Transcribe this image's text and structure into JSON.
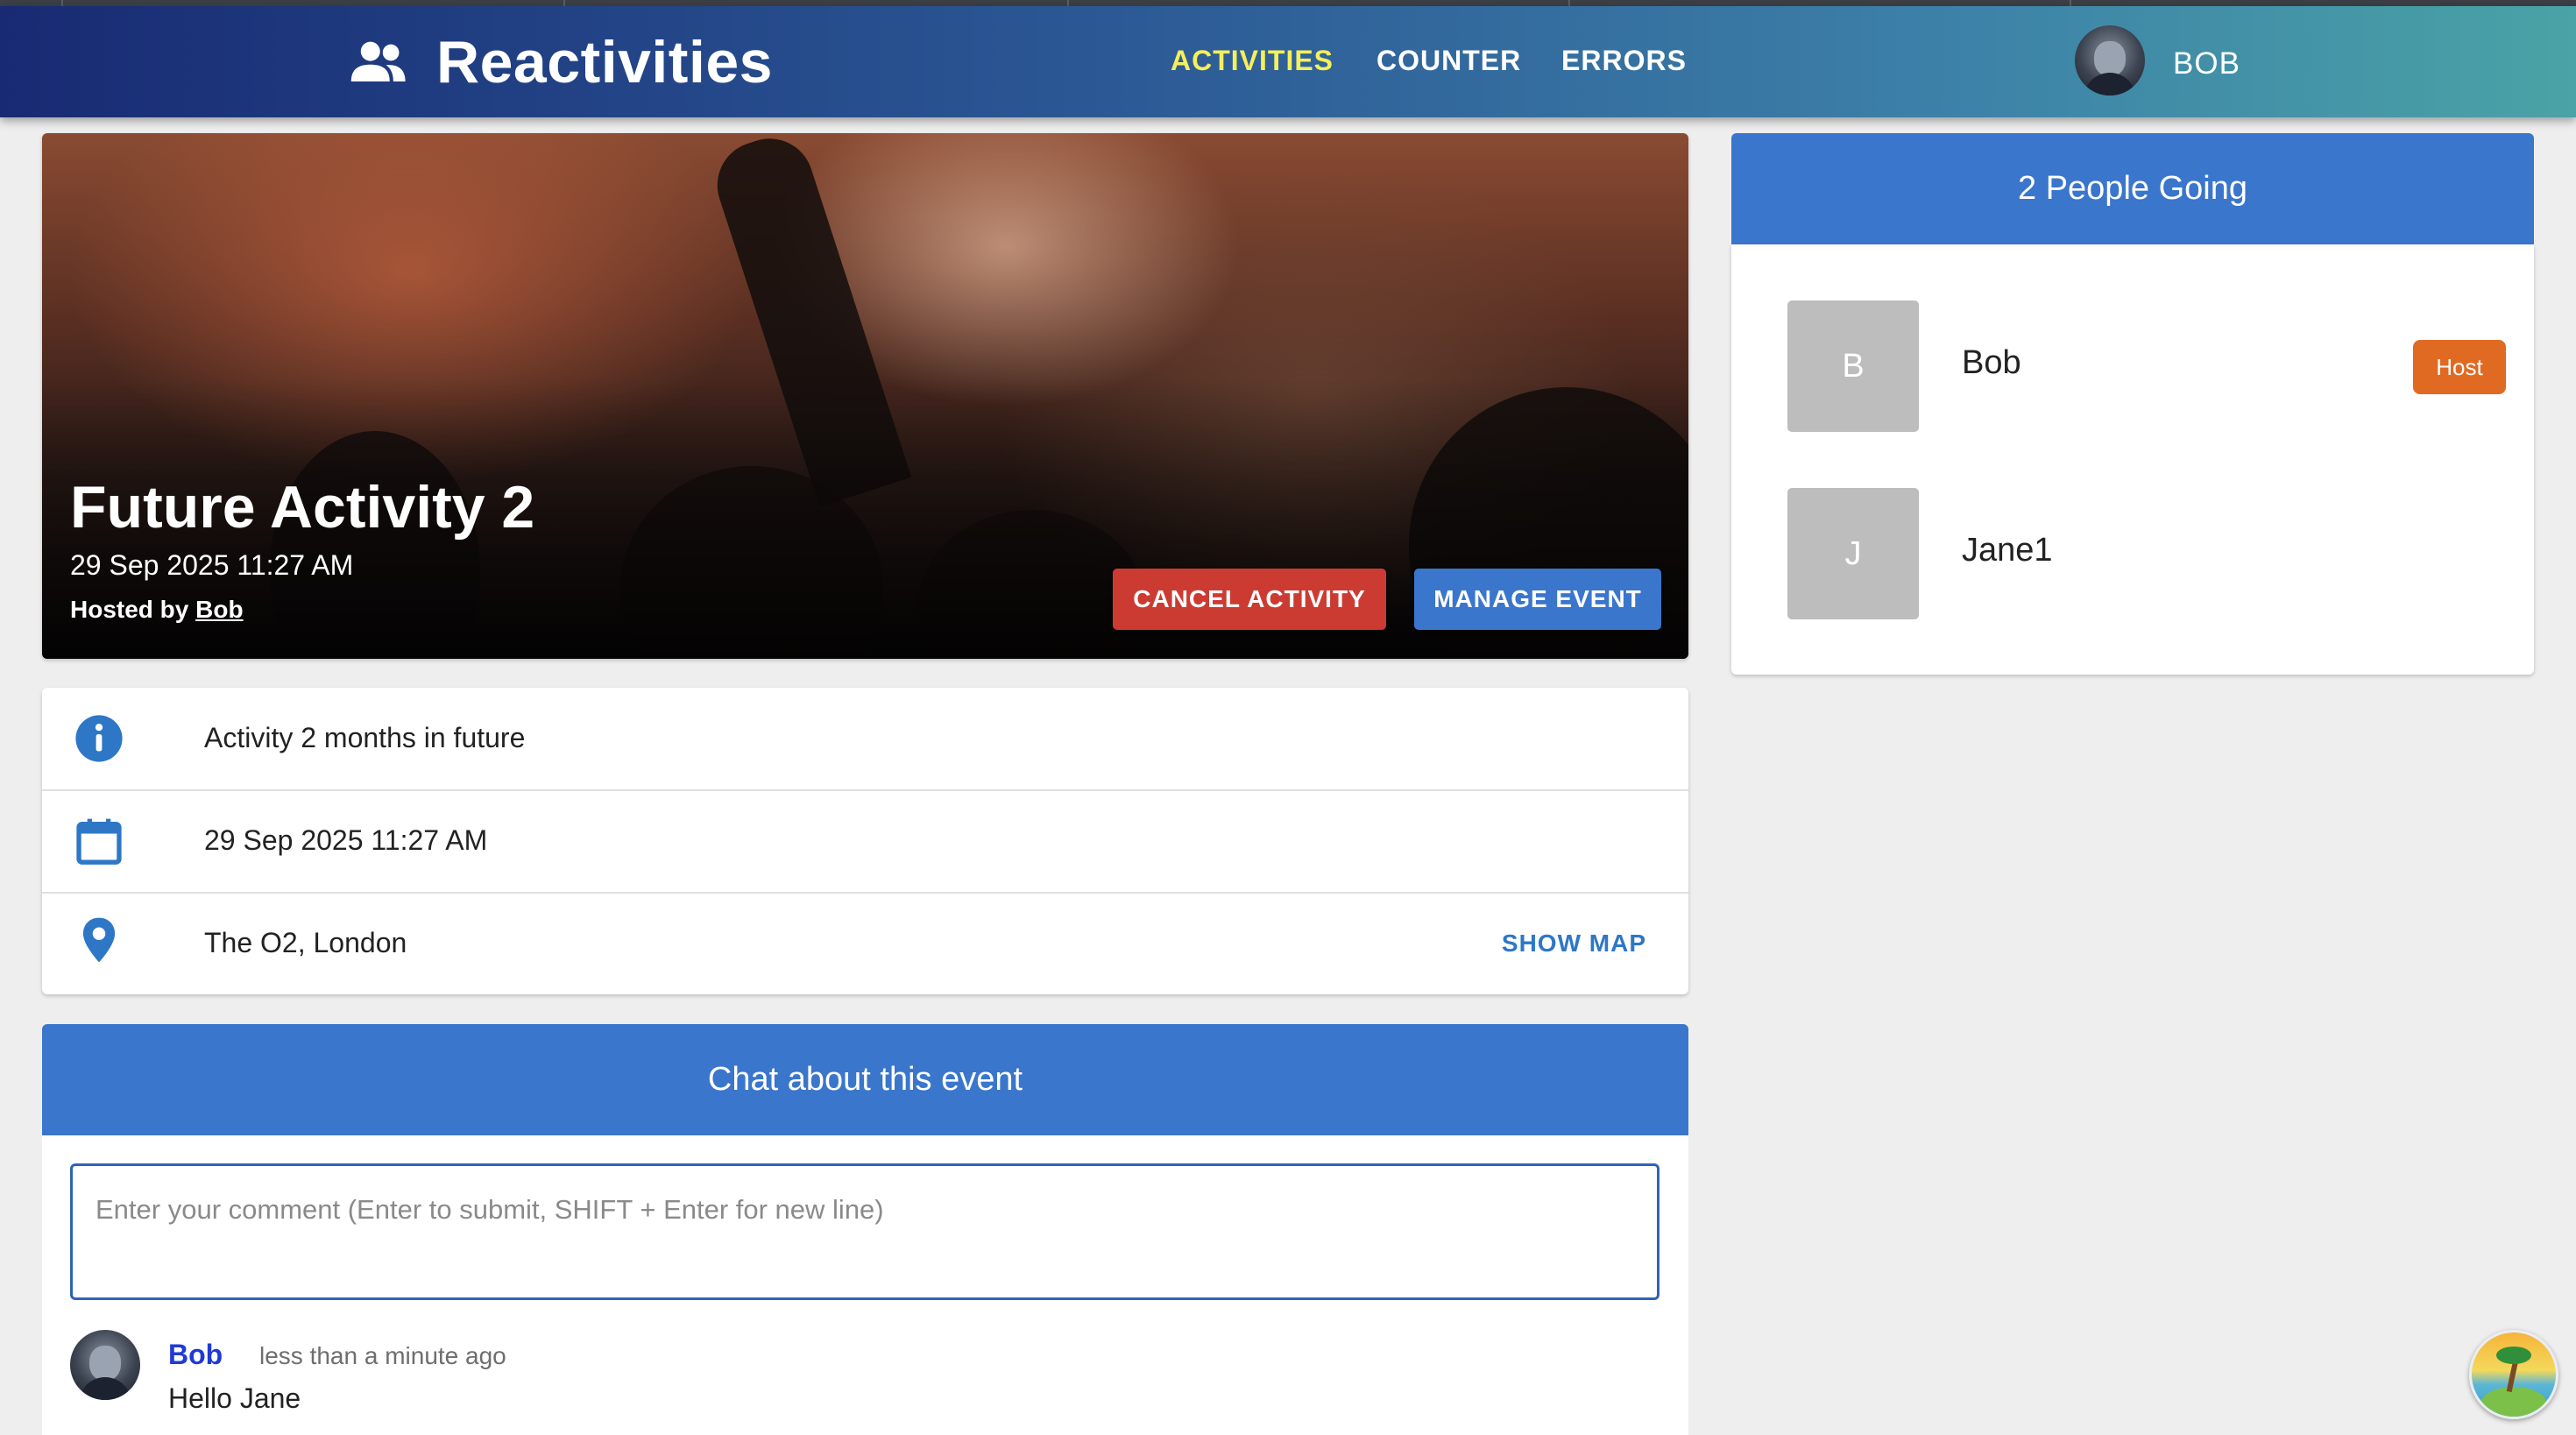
{
  "navbar": {
    "brand": "Reactivities",
    "links": [
      {
        "label": "ACTIVITIES",
        "active": true
      },
      {
        "label": "COUNTER",
        "active": false
      },
      {
        "label": "ERRORS",
        "active": false
      }
    ],
    "user": {
      "display_name": "BOB"
    }
  },
  "activity": {
    "title": "Future Activity 2",
    "date": "29 Sep 2025 11:27 AM",
    "hosted_prefix": "Hosted by ",
    "host_name": "Bob",
    "cancel_label": "CANCEL ACTIVITY",
    "manage_label": "MANAGE EVENT"
  },
  "details": {
    "description": "Activity 2 months in future",
    "date": "29 Sep 2025 11:27 AM",
    "venue": "The O2, London",
    "show_map_label": "SHOW MAP"
  },
  "chat": {
    "header": "Chat about this event",
    "placeholder": "Enter your comment (Enter to submit, SHIFT + Enter for new line)",
    "comments": [
      {
        "author": "Bob",
        "time": "less than a minute ago",
        "text": "Hello Jane"
      }
    ]
  },
  "attendees": {
    "header": "2 People Going",
    "people": [
      {
        "initial": "B",
        "name": "Bob",
        "badge": "Host"
      },
      {
        "initial": "J",
        "name": "Jane1"
      }
    ]
  },
  "colors": {
    "primary": "#3a76cc",
    "danger": "#cc3b32",
    "host_badge": "#e06a22",
    "active_nav": "#f5ef5a",
    "comment_author": "#1f3ad6"
  },
  "icons": {
    "brand": "users-icon",
    "description": "info-icon",
    "date": "calendar-icon",
    "venue": "map-pin-icon"
  }
}
